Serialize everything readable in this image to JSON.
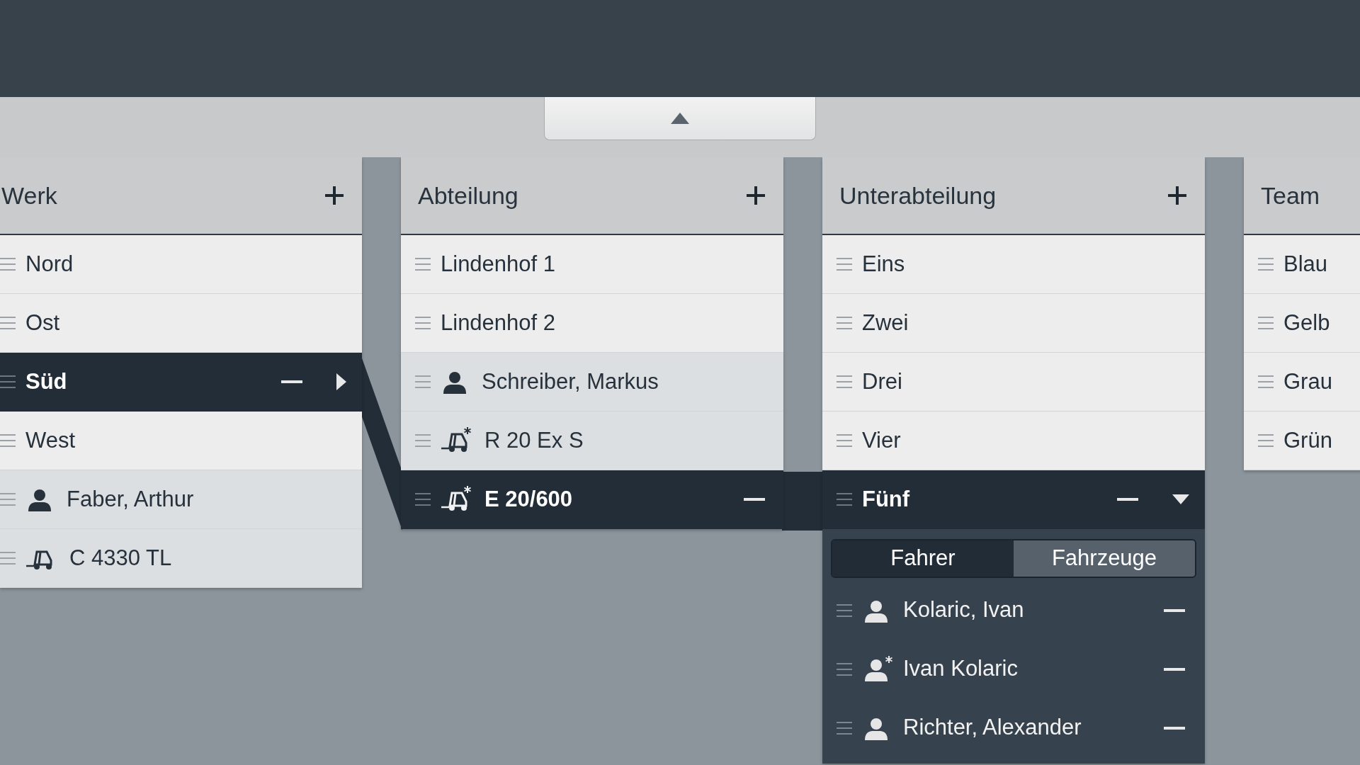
{
  "columns": [
    {
      "title": "Werk",
      "items": [
        {
          "kind": "group",
          "label": "Nord",
          "selected": false
        },
        {
          "kind": "group",
          "label": "Ost",
          "selected": false
        },
        {
          "kind": "group",
          "label": "Süd",
          "selected": true,
          "expanded": false
        },
        {
          "kind": "group",
          "label": "West",
          "selected": false
        },
        {
          "kind": "driver",
          "label": "Faber, Arthur",
          "selected": false,
          "starred": false
        },
        {
          "kind": "vehicle",
          "label": "C 4330 TL",
          "selected": false,
          "starred": false
        }
      ]
    },
    {
      "title": "Abteilung",
      "items": [
        {
          "kind": "group",
          "label": "Lindenhof 1",
          "selected": false
        },
        {
          "kind": "group",
          "label": "Lindenhof 2",
          "selected": false
        },
        {
          "kind": "driver",
          "label": "Schreiber, Markus",
          "selected": false,
          "starred": false
        },
        {
          "kind": "vehicle",
          "label": "R 20 Ex S",
          "selected": false,
          "starred": true
        },
        {
          "kind": "vehicle",
          "label": "E 20/600",
          "selected": true,
          "starred": true
        }
      ]
    },
    {
      "title": "Unterabteilung",
      "items": [
        {
          "kind": "group",
          "label": "Eins",
          "selected": false
        },
        {
          "kind": "group",
          "label": "Zwei",
          "selected": false
        },
        {
          "kind": "group",
          "label": "Drei",
          "selected": false
        },
        {
          "kind": "group",
          "label": "Vier",
          "selected": false
        },
        {
          "kind": "group",
          "label": "Fünf",
          "selected": true,
          "expanded": true,
          "detail": {
            "tabs": [
              {
                "label": "Fahrer",
                "selected": true
              },
              {
                "label": "Fahrzeuge",
                "selected": false
              }
            ],
            "members": [
              {
                "label": "Kolaric, Ivan",
                "starred": false
              },
              {
                "label": "Ivan Kolaric",
                "starred": true
              },
              {
                "label": "Richter, Alexander",
                "starred": false
              }
            ]
          }
        }
      ]
    },
    {
      "title": "Team",
      "items": [
        {
          "kind": "group",
          "label": "Blau",
          "selected": false
        },
        {
          "kind": "group",
          "label": "Gelb",
          "selected": false
        },
        {
          "kind": "group",
          "label": "Grau",
          "selected": false
        },
        {
          "kind": "group",
          "label": "Grün",
          "selected": false
        }
      ]
    }
  ]
}
